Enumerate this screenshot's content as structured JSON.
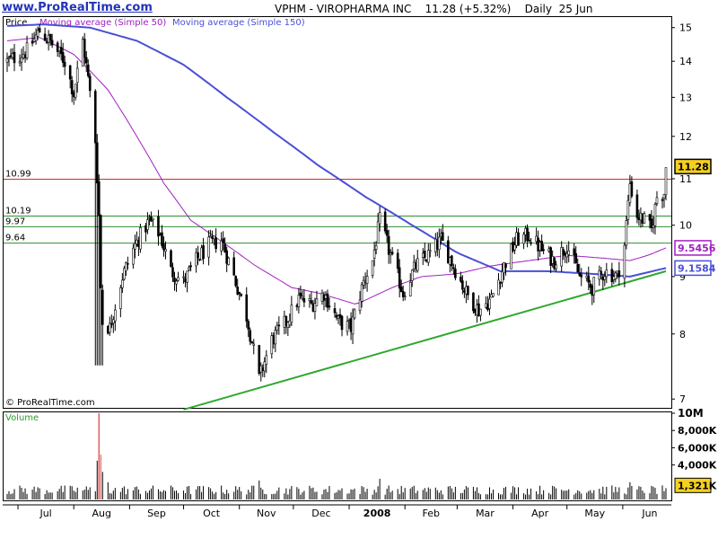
{
  "header": {
    "site": "www.ProRealTime.com",
    "title": "VPHM - VIROPHARMA INC    11.28 (+5.32%)    Daily  25 Jun"
  },
  "watermark": "© ProRealTime.com",
  "colors": {
    "price": "#000000",
    "ma50": "#a020c0",
    "ma150": "#4a4fd8",
    "trendline": "#2fa82f",
    "resistance": "#d42a2a",
    "support": "#2f8f2f",
    "volume": "#000000"
  },
  "chart_data": [
    {
      "type": "candlestick",
      "legend": [
        "Price",
        "Moving average (Simple 50)",
        "Moving average (Simple 150)"
      ],
      "x_tick_labels": [
        "Jul",
        "Aug",
        "Sep",
        "Oct",
        "Nov",
        "Dec",
        "2008",
        "Feb",
        "Mar",
        "Apr",
        "May",
        "Jun"
      ],
      "y_tick_labels": [
        "15",
        "14",
        "13",
        "12",
        "11",
        "10",
        "9",
        "8",
        "7"
      ],
      "ylim": [
        6.9,
        15.3
      ],
      "log_scale": true,
      "horizontal_lines": [
        {
          "label": "10.99",
          "value": 10.99
        },
        {
          "label": "10.19",
          "value": 10.19
        },
        {
          "label": "9.97",
          "value": 9.97
        },
        {
          "label": "9.64",
          "value": 9.64
        }
      ],
      "value_flags": [
        {
          "label": "11.28",
          "value": 11.28,
          "series": "price"
        },
        {
          "label": "9.5456",
          "value": 9.5456,
          "series": "ma50"
        },
        {
          "label": "9.1584",
          "value": 9.1584,
          "series": "ma150"
        }
      ],
      "anchors": [
        [
          "2007-06-25",
          14.0
        ],
        [
          "2007-06-29",
          14.1
        ],
        [
          "2007-07-06",
          14.3
        ],
        [
          "2007-07-13",
          14.9
        ],
        [
          "2007-07-20",
          14.5
        ],
        [
          "2007-07-27",
          14.0
        ],
        [
          "2007-08-01",
          13.1
        ],
        [
          "2007-08-06",
          14.6
        ],
        [
          "2007-08-09",
          13.5
        ],
        [
          "2007-08-13",
          11.9
        ],
        [
          "2007-08-15",
          10.2
        ],
        [
          "2007-08-16",
          8.8
        ],
        [
          "2007-08-17",
          8.2
        ],
        [
          "2007-08-21",
          8.1
        ],
        [
          "2007-08-28",
          9.0
        ],
        [
          "2007-09-04",
          9.6
        ],
        [
          "2007-09-12",
          10.1
        ],
        [
          "2007-09-18",
          9.8
        ],
        [
          "2007-09-24",
          9.1
        ],
        [
          "2007-10-01",
          8.9
        ],
        [
          "2007-10-08",
          9.3
        ],
        [
          "2007-10-15",
          9.6
        ],
        [
          "2007-10-22",
          9.7
        ],
        [
          "2007-10-29",
          9.0
        ],
        [
          "2007-11-05",
          8.3
        ],
        [
          "2007-11-12",
          7.3
        ],
        [
          "2007-11-19",
          7.9
        ],
        [
          "2007-11-27",
          8.2
        ],
        [
          "2007-12-04",
          8.6
        ],
        [
          "2007-12-11",
          8.5
        ],
        [
          "2007-12-18",
          8.7
        ],
        [
          "2007-12-26",
          8.2
        ],
        [
          "2008-01-02",
          8.1
        ],
        [
          "2008-01-09",
          8.9
        ],
        [
          "2008-01-14",
          9.3
        ],
        [
          "2008-01-18",
          10.1
        ],
        [
          "2008-01-24",
          9.4
        ],
        [
          "2008-01-31",
          8.7
        ],
        [
          "2008-02-07",
          9.2
        ],
        [
          "2008-02-14",
          9.4
        ],
        [
          "2008-02-21",
          9.7
        ],
        [
          "2008-02-28",
          9.2
        ],
        [
          "2008-03-06",
          8.7
        ],
        [
          "2008-03-13",
          8.4
        ],
        [
          "2008-03-20",
          8.6
        ],
        [
          "2008-03-27",
          9.2
        ],
        [
          "2008-04-03",
          9.7
        ],
        [
          "2008-04-10",
          9.8
        ],
        [
          "2008-04-17",
          9.5
        ],
        [
          "2008-04-24",
          9.3
        ],
        [
          "2008-05-01",
          9.6
        ],
        [
          "2008-05-08",
          9.0
        ],
        [
          "2008-05-15",
          8.8
        ],
        [
          "2008-05-22",
          9.1
        ],
        [
          "2008-05-29",
          9.0
        ],
        [
          "2008-06-02",
          9.6
        ],
        [
          "2008-06-05",
          10.9
        ],
        [
          "2008-06-09",
          10.2
        ],
        [
          "2008-06-13",
          10.1
        ],
        [
          "2008-06-17",
          9.9
        ],
        [
          "2008-06-20",
          10.6
        ],
        [
          "2008-06-24",
          10.7
        ],
        [
          "2008-06-25",
          11.28
        ]
      ],
      "ma50": [
        [
          "2007-06-25",
          14.6
        ],
        [
          "2007-07-13",
          14.7
        ],
        [
          "2007-08-01",
          14.2
        ],
        [
          "2007-08-20",
          13.2
        ],
        [
          "2007-09-05",
          12.0
        ],
        [
          "2007-09-20",
          10.9
        ],
        [
          "2007-10-05",
          10.1
        ],
        [
          "2007-10-25",
          9.6
        ],
        [
          "2007-11-10",
          9.2
        ],
        [
          "2007-11-30",
          8.8
        ],
        [
          "2007-12-15",
          8.7
        ],
        [
          "2008-01-05",
          8.5
        ],
        [
          "2008-01-25",
          8.8
        ],
        [
          "2008-02-10",
          9.0
        ],
        [
          "2008-03-01",
          9.05
        ],
        [
          "2008-03-20",
          9.2
        ],
        [
          "2008-04-10",
          9.3
        ],
        [
          "2008-05-01",
          9.4
        ],
        [
          "2008-05-20",
          9.35
        ],
        [
          "2008-06-05",
          9.3
        ],
        [
          "2008-06-15",
          9.4
        ],
        [
          "2008-06-25",
          9.5456
        ]
      ],
      "ma150": [
        [
          "2007-06-25",
          15.05
        ],
        [
          "2007-07-15",
          15.1
        ],
        [
          "2007-08-10",
          15.0
        ],
        [
          "2007-09-05",
          14.6
        ],
        [
          "2007-10-01",
          13.9
        ],
        [
          "2007-10-25",
          13.0
        ],
        [
          "2007-11-20",
          12.1
        ],
        [
          "2007-12-15",
          11.3
        ],
        [
          "2008-01-10",
          10.6
        ],
        [
          "2008-02-05",
          10.0
        ],
        [
          "2008-03-01",
          9.45
        ],
        [
          "2008-03-25",
          9.1
        ],
        [
          "2008-04-20",
          9.1
        ],
        [
          "2008-05-15",
          9.05
        ],
        [
          "2008-06-05",
          9.0
        ],
        [
          "2008-06-25",
          9.1584
        ]
      ],
      "trendline": [
        [
          "2007-10-01",
          6.85
        ],
        [
          "2008-06-25",
          9.1
        ]
      ]
    },
    {
      "type": "bar",
      "legend": [
        "Volume"
      ],
      "y_tick_labels": [
        "10M",
        "8,000K",
        "6,000K",
        "4,000K"
      ],
      "ylim": [
        0,
        10000000
      ],
      "current_label": "1,321K",
      "current_value": 1321000,
      "baseline_volume": 1100000,
      "spikes": [
        [
          "2007-08-14",
          4500000
        ],
        [
          "2007-08-15",
          10000000
        ],
        [
          "2007-08-16",
          5200000
        ],
        [
          "2007-08-17",
          3200000
        ],
        [
          "2007-08-20",
          2000000
        ],
        [
          "2007-11-12",
          2200000
        ],
        [
          "2008-01-18",
          2400000
        ],
        [
          "2008-06-05",
          2000000
        ]
      ]
    }
  ]
}
